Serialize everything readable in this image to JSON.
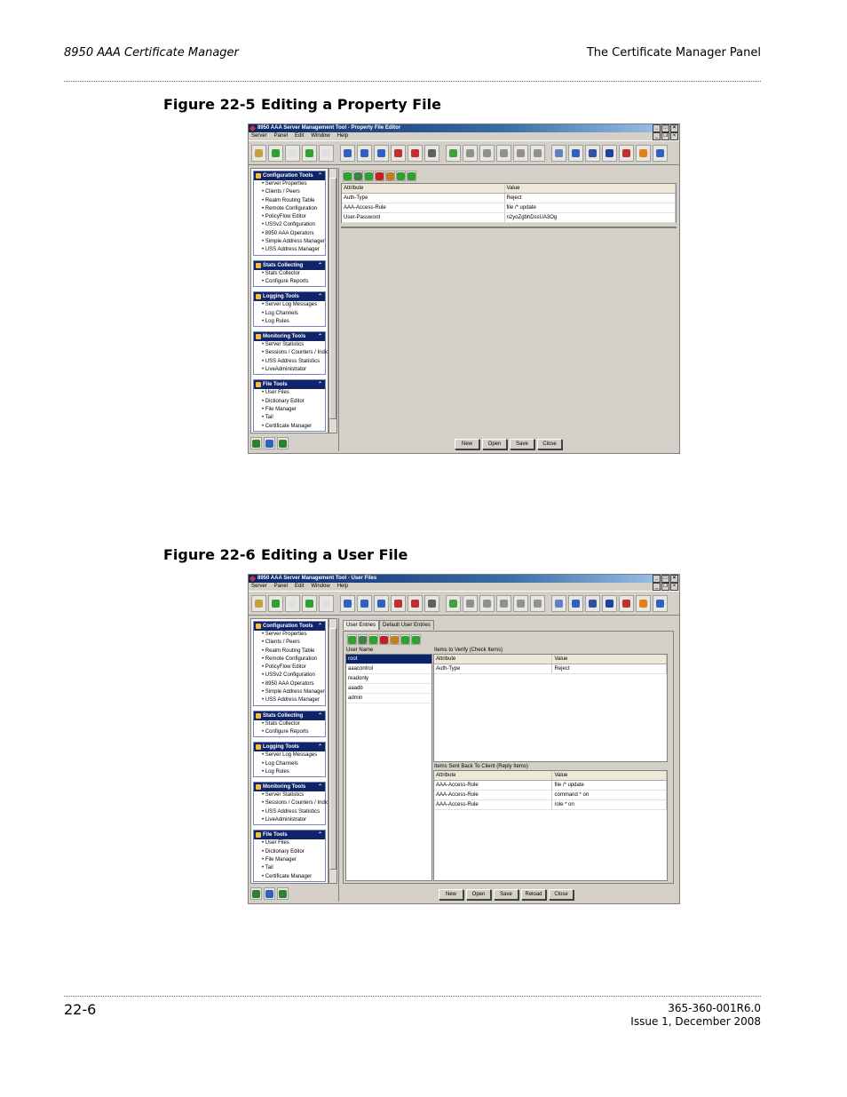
{
  "page": {
    "header_left": "8950 AAA Certificate Manager",
    "header_right": "The Certificate Manager Panel",
    "footer_left": "22-6",
    "footer_right_line1": "365-360-001R6.0",
    "footer_right_line2": "Issue 1, December 2008"
  },
  "figures": [
    {
      "number": "Figure 22-5",
      "title": "Editing a Property File"
    },
    {
      "number": "Figure 22-6",
      "title": "Editing a User File"
    }
  ],
  "menu": [
    "Server",
    "Panel",
    "Edit",
    "Window",
    "Help"
  ],
  "sidebar": {
    "sections": [
      {
        "title": "Configuration Tools",
        "items": [
          "Server Properties",
          "Clients / Peers",
          "Realm Routing Table",
          "Remote Configuration",
          "PolicyFlow Editor",
          "USSv2 Configuration",
          "8950 AAA Operators",
          "Simple Address Manager",
          "USS Address Manager"
        ]
      },
      {
        "title": "Stats Collecting",
        "items": [
          "Stats Collector",
          "Configure Reports"
        ]
      },
      {
        "title": "Logging Tools",
        "items": [
          "Server Log Messages",
          "Log Channels",
          "Log Rules"
        ]
      },
      {
        "title": "Monitoring Tools",
        "items": [
          "Server Statistics",
          "Sessions / Counters / Indices",
          "USS Address Statistics",
          "LiveAdministrator"
        ]
      },
      {
        "title": "File Tools",
        "items": [
          "User Files",
          "Dictionary Editor",
          "File Manager",
          "Tail",
          "Certificate Manager"
        ]
      }
    ]
  },
  "window1": {
    "title": "8950 AAA Server Management Tool - Property File Editor",
    "columns": [
      "Attribute",
      "Value"
    ],
    "rows": [
      [
        "Auth-Type",
        "Reject"
      ],
      [
        "AAA-Access-Rule",
        "file /* update"
      ],
      [
        "User-Password",
        "n2yoZgbhDssUA3Og"
      ]
    ],
    "buttons": [
      "New",
      "Open",
      "Save",
      "Close"
    ]
  },
  "window2": {
    "title": "8950 AAA Server Management Tool - User Files",
    "tabs": [
      "User Entries",
      "Default User Entries"
    ],
    "user_list_label": "User Name",
    "users": [
      "root",
      "aaacontrol",
      "readonly",
      "aaadb",
      "admin"
    ],
    "check_label": "Items to Verify (Check Items)",
    "check_columns": [
      "Attribute",
      "Value"
    ],
    "check_rows": [
      [
        "Auth-Type",
        "Reject"
      ]
    ],
    "reply_label": "Items Sent Back To Client (Reply Items)",
    "reply_columns": [
      "Attribute",
      "Value"
    ],
    "reply_rows": [
      [
        "AAA-Access-Rule",
        "file /* update"
      ],
      [
        "AAA-Access-Rule",
        "command * on"
      ],
      [
        "AAA-Access-Rule",
        "role * on"
      ]
    ],
    "buttons": [
      "New",
      "Open",
      "Save",
      "Reload",
      "Close"
    ]
  },
  "toolbar_icon_colors": [
    "#c8a040",
    "#30a030",
    "#e0e0e0",
    "#30a030",
    "#e0e0e0",
    "#3060c0",
    "#3060c0",
    "#3060c0",
    "#c03030",
    "#c03030",
    "#606060",
    "#40a040",
    "#909090",
    "#909090",
    "#909090",
    "#909090",
    "#909090",
    "#6080c0",
    "#3060c0",
    "#3050a0",
    "#2040a0",
    "#c03030",
    "#e08020",
    "#3060c0"
  ]
}
